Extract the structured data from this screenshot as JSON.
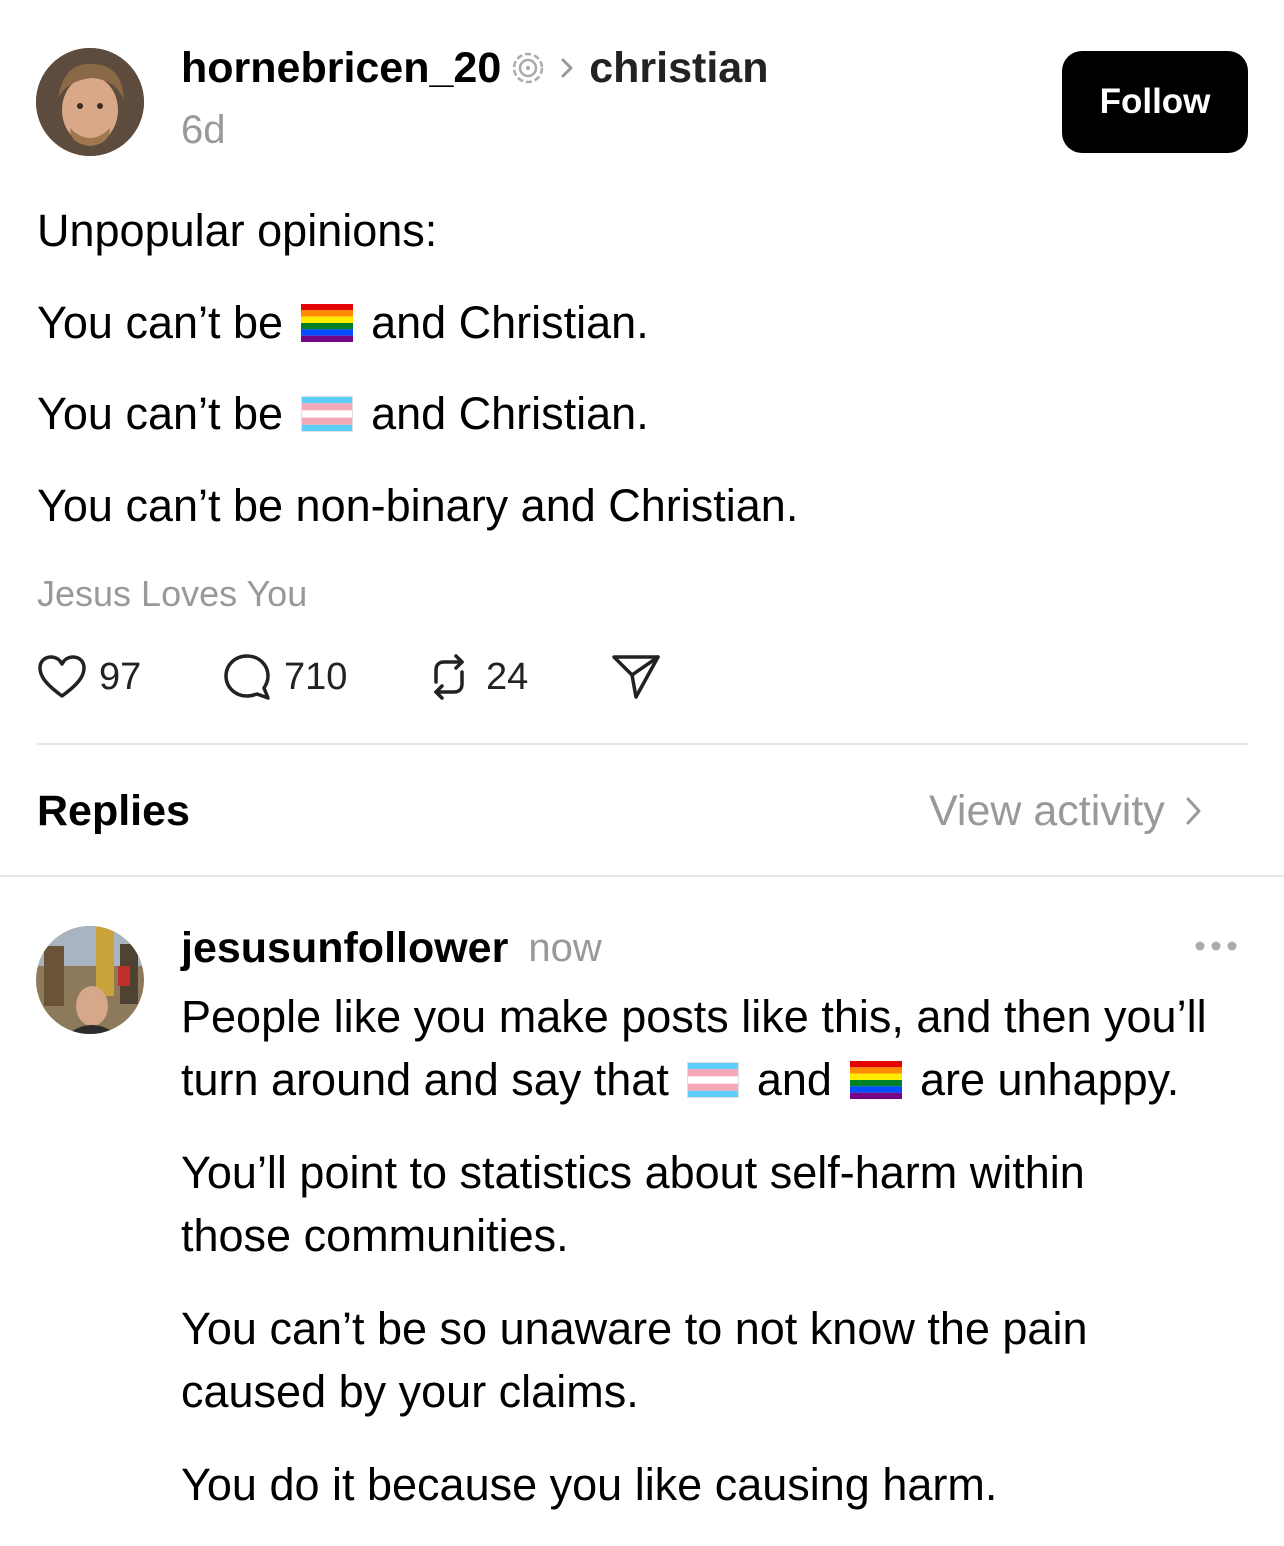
{
  "post": {
    "username": "hornebricen_20",
    "topic": "christian",
    "time": "6d",
    "follow_label": "Follow",
    "heading": "Unpopular opinions:",
    "line1_pre": "You can’t be",
    "line1_post": "and Christian.",
    "line2_pre": "You can’t be",
    "line2_post": "and Christian.",
    "line3": "You can’t be non-binary and Christian.",
    "signature": "Jesus Loves You",
    "likes": "97",
    "comments": "710",
    "reposts": "24"
  },
  "replies_header": {
    "title": "Replies",
    "view_activity": "View activity"
  },
  "reply": {
    "username": "jesusunfollower",
    "time": "now",
    "line1": "People like you make posts like this, and then you’ll",
    "line2_pre": "turn around and say that",
    "line2_mid": "and",
    "line2_post": "are unhappy.",
    "para2": "You’ll point to statistics about self-harm within those communities.",
    "para3": "You can’t be so unaware to not know the pain caused by your claims.",
    "para4": "You do it because you like causing harm."
  },
  "colors": {
    "rainbow": [
      "#e40303",
      "#ff8c00",
      "#ffed00",
      "#008026",
      "#004dff",
      "#750787"
    ],
    "trans": [
      "#5bcefa",
      "#f5a9b8",
      "#ffffff",
      "#f5a9b8",
      "#5bcefa"
    ]
  },
  "icons": [
    "verified-badge-icon",
    "chevron-right-icon",
    "heart-icon",
    "comment-icon",
    "repost-icon",
    "share-icon",
    "more-icon"
  ]
}
